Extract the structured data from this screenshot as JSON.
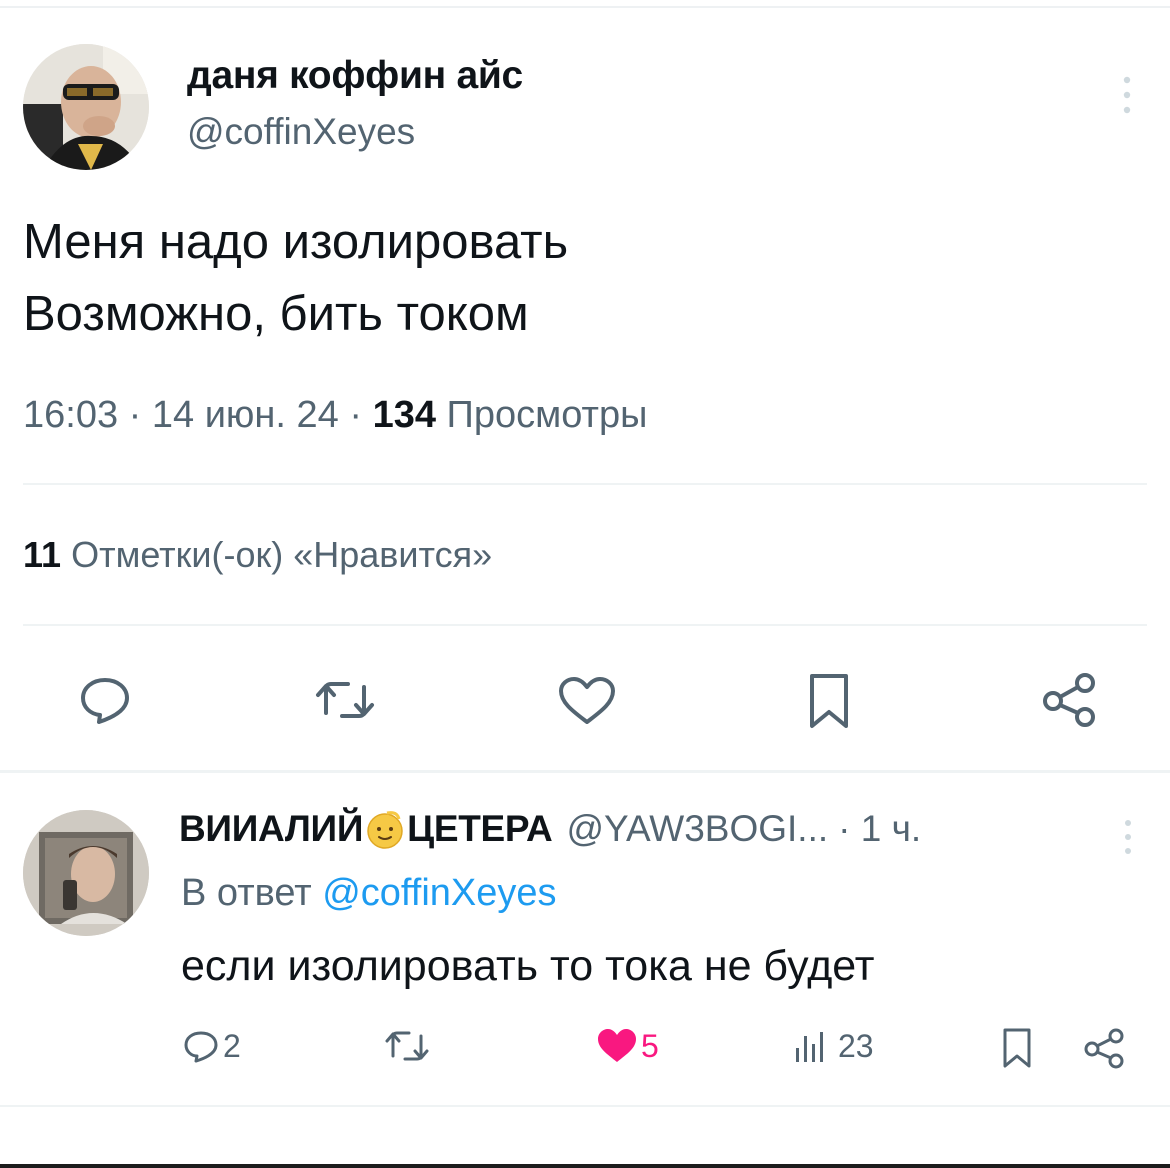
{
  "tweet": {
    "author_name": "даня коффин айс",
    "author_handle": "@coffinXeyes",
    "avatar_icon": "user-avatar-photo",
    "more_icon": "more-vertical-icon",
    "text_lines": [
      "Меня надо изолировать",
      "Возможно, бить током"
    ],
    "time": "16:03",
    "date": "14 июн. 24",
    "views_count": "134",
    "views_label": "Просмотры",
    "likes_count": "11",
    "likes_label": "Отметки(-ок) «Нравится»",
    "actions": [
      "reply-icon",
      "retweet-icon",
      "like-icon",
      "bookmark-icon",
      "share-icon"
    ]
  },
  "reply": {
    "author_name_part1": "ВИИАЛИЙ",
    "author_emoji": "emoji-face-icon",
    "author_name_part2": "ЦЕТЕРА",
    "author_handle": "@YAW3BOGI...",
    "time": "· 1 ч.",
    "reply_to_label": "В ответ",
    "reply_to_mention": "@coffinXeyes",
    "text": "если изолировать то тока не будет",
    "replies_count": "2",
    "likes_count": "5",
    "views_count": "23"
  },
  "colors": {
    "text": "#0f1419",
    "secondary": "#536471",
    "link": "#1d9bf0",
    "like": "#f91880",
    "divider": "#eff3f4"
  }
}
